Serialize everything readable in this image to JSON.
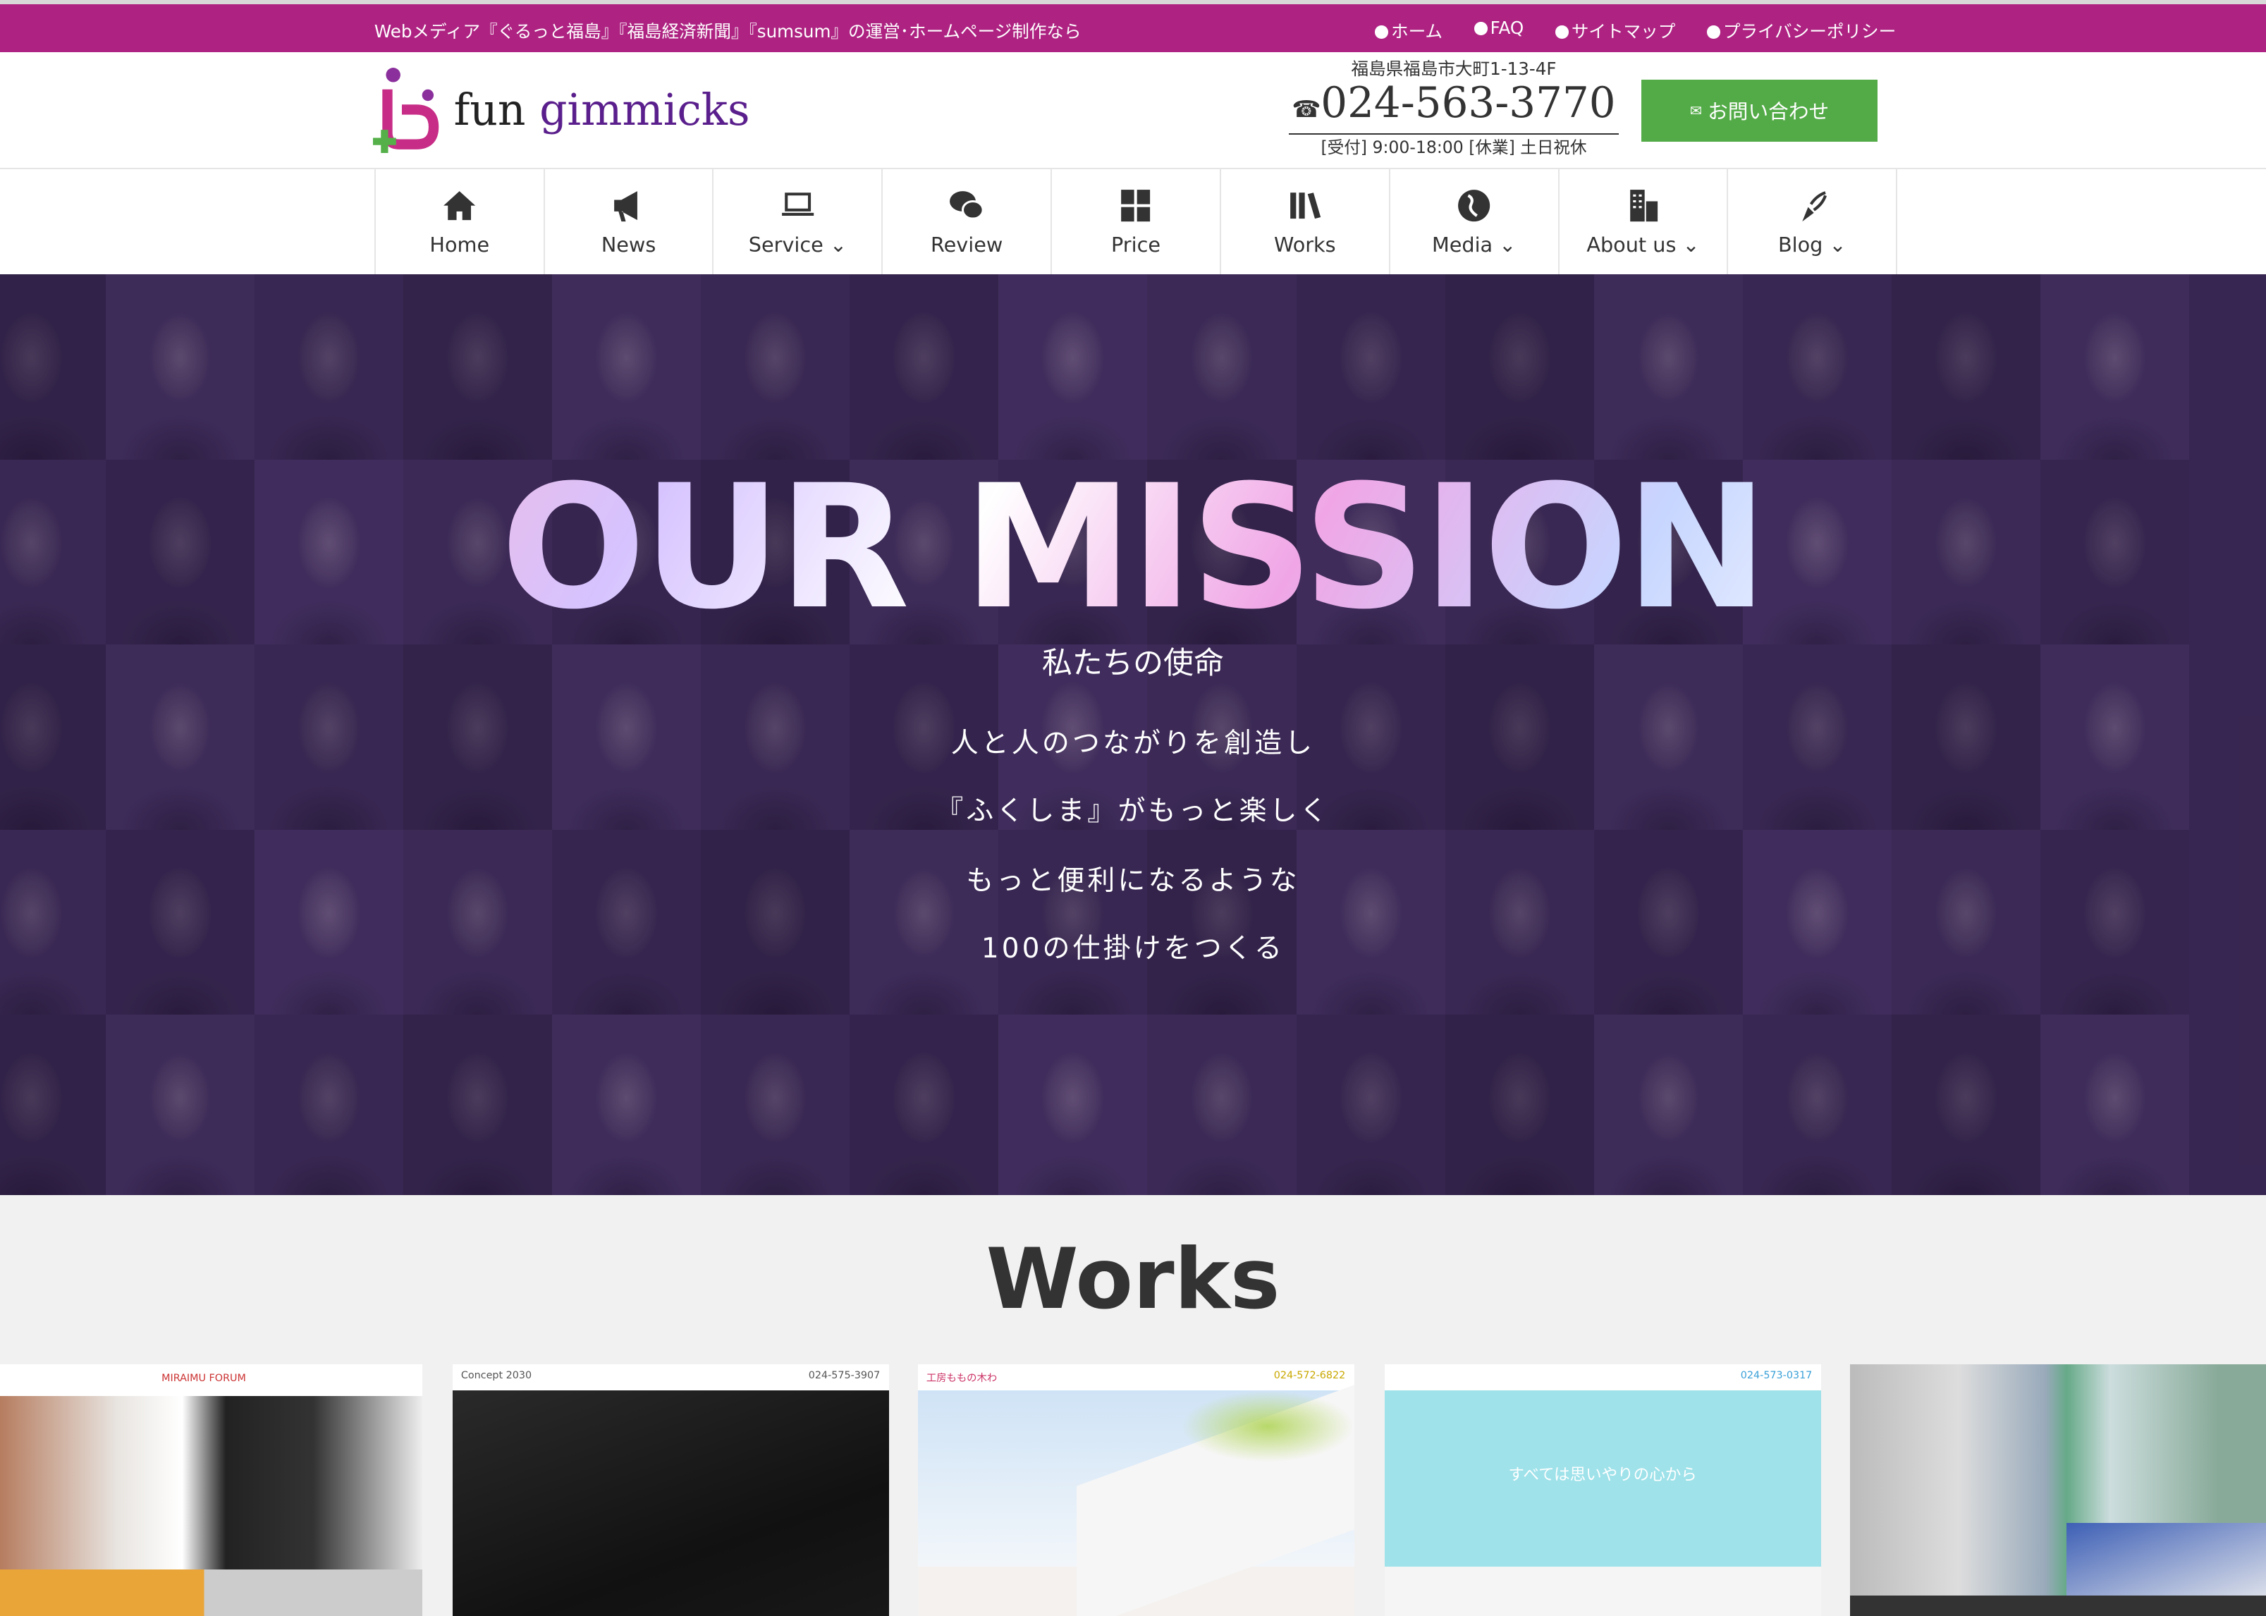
{
  "topbar": {
    "message": "Webメディア『ぐるっと福島』『福島経済新聞』『sumsum』の運営･ホームページ制作なら",
    "links": [
      {
        "label": "ホーム"
      },
      {
        "label": "FAQ"
      },
      {
        "label": "サイトマップ"
      },
      {
        "label": "プライバシーポリシー"
      }
    ],
    "color": "#ae2382"
  },
  "header": {
    "logo_text_1": "fun ",
    "logo_text_2": "gimmicks",
    "logo_text_3": "",
    "address": "福島県福島市大町1-13-4F",
    "phone": "024-563-3770",
    "hours": "[受付] 9:00-18:00 [休業] 土日祝休",
    "contact_button": "お問い合わせ",
    "contact_color": "#53ab47"
  },
  "nav": {
    "items": [
      {
        "label": "Home",
        "icon": "home-icon"
      },
      {
        "label": "News",
        "icon": "megaphone-icon"
      },
      {
        "label": "Service ⌄",
        "icon": "laptop-icon"
      },
      {
        "label": "Review",
        "icon": "chat-icon"
      },
      {
        "label": "Price",
        "icon": "calculator-icon"
      },
      {
        "label": "Works",
        "icon": "books-icon"
      },
      {
        "label": "Media ⌄",
        "icon": "globe-icon"
      },
      {
        "label": "About us ⌄",
        "icon": "building-icon"
      },
      {
        "label": "Blog ⌄",
        "icon": "pen-icon"
      }
    ]
  },
  "hero": {
    "title": "OUR MISSION",
    "subtitle": "私たちの使命",
    "lines": [
      "人と人のつながりを創造し",
      "『ふくしま』がもっと楽しく",
      "もっと便利になるような",
      "100の仕掛けをつくる"
    ]
  },
  "works": {
    "title": "Works",
    "cards": [
      {
        "site": "MIRAIMU FORUM"
      },
      {
        "site": "Concept 2030",
        "phone": "024-575-3907"
      },
      {
        "site": "工房ももの木わ",
        "phone": "024-572-6822"
      },
      {
        "site": "",
        "phone": "024-573-0317",
        "headline": "すべては思いやりの心から"
      },
      {
        "site": ""
      }
    ]
  }
}
